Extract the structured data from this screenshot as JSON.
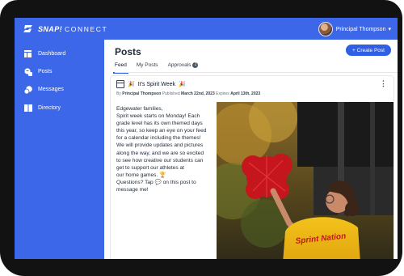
{
  "app": {
    "logo_text": "SNAP!",
    "logo_sub": "CONNECT",
    "brand_color": "#3b67e8",
    "accent_color": "#2f5fe3"
  },
  "user": {
    "name": "Principal Thompson"
  },
  "sidebar": {
    "items": [
      {
        "label": "Dashboard",
        "icon": "dashboard-icon"
      },
      {
        "label": "Posts",
        "icon": "posts-icon"
      },
      {
        "label": "Messages",
        "icon": "messages-icon"
      },
      {
        "label": "Directory",
        "icon": "directory-icon"
      }
    ]
  },
  "main": {
    "title": "Posts",
    "create_button": "+ Create Post",
    "tabs": [
      {
        "label": "Feed",
        "active": true
      },
      {
        "label": "My Posts",
        "active": false
      },
      {
        "label": "Approvals",
        "active": false,
        "badge": "1"
      }
    ]
  },
  "post": {
    "title": "It's Spirit Week",
    "meta": {
      "by_label": "By",
      "author": "Principal Thompson",
      "published_label": "Published",
      "published": "March 22nd, 2023",
      "expires_label": "Expires",
      "expires": "April 13th, 2023"
    },
    "body_lines": [
      "Edgewater families,",
      "Spirit week starts on Monday! Each",
      "grade level has its own themed days",
      "this year, so keep an eye on your feed",
      "for a calendar including the themes!",
      "We will provide updates and pictures",
      "along the way, and we are so excited",
      "to see how creative our students can",
      "get to support our athletes at",
      "our home games. 🏆",
      "Questions? Tap 💬 on this post to",
      "message me!"
    ],
    "image_shirt_text": "Sprint Nation"
  }
}
